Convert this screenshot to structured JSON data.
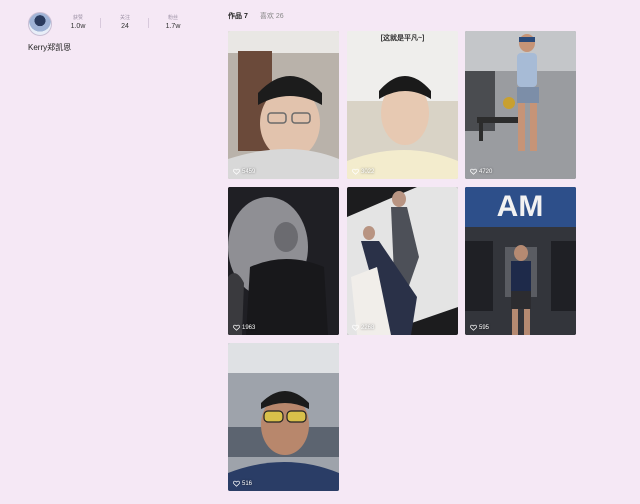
{
  "profile": {
    "username": "Kerry郑凯恩",
    "stats": [
      {
        "label": "获赞",
        "value": "1.0w"
      },
      {
        "label": "关注",
        "value": "24"
      },
      {
        "label": "粉丝",
        "value": "1.7w"
      }
    ]
  },
  "tabs": [
    {
      "label": "作品",
      "count": "7",
      "active": true
    },
    {
      "label": "喜欢",
      "count": "26",
      "active": false
    }
  ],
  "posts": [
    {
      "likes": "5459",
      "overlay": ""
    },
    {
      "likes": "3022",
      "overlay": "[这就是平凡~]"
    },
    {
      "likes": "4720",
      "overlay": ""
    },
    {
      "likes": "1963",
      "overlay": ""
    },
    {
      "likes": "2268",
      "overlay": ""
    },
    {
      "likes": "595",
      "overlay": ""
    },
    {
      "likes": "516",
      "overlay": ""
    }
  ]
}
